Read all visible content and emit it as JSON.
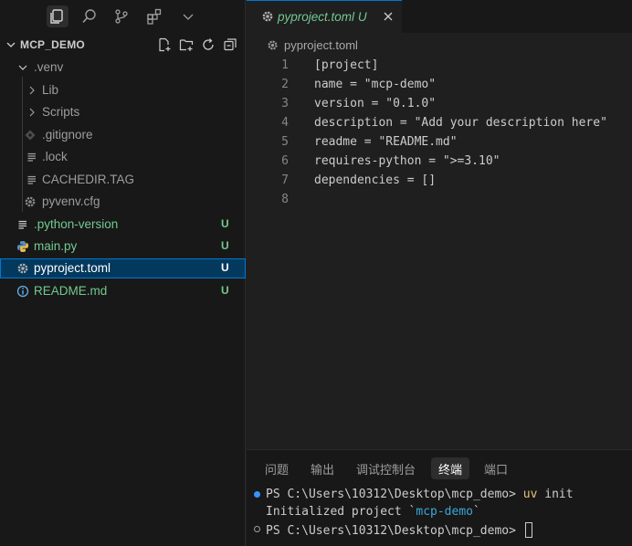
{
  "activity_bar": {
    "icons": [
      "explorer-icon",
      "search-icon",
      "source-control-icon",
      "extensions-icon",
      "more-chevron-icon"
    ]
  },
  "explorer": {
    "title": "MCP_DEMO",
    "actions": [
      "new-file-icon",
      "new-folder-icon",
      "refresh-icon",
      "collapse-all-icon"
    ],
    "items": [
      {
        "label": ".venv",
        "icon": "chevron-down-icon",
        "badge": ""
      },
      {
        "label": "Lib",
        "icon": "chevron-right-icon",
        "badge": ""
      },
      {
        "label": "Scripts",
        "icon": "chevron-right-icon",
        "badge": ""
      },
      {
        "label": ".gitignore",
        "icon": "gitignore-icon",
        "badge": ""
      },
      {
        "label": ".lock",
        "icon": "text-file-icon",
        "badge": ""
      },
      {
        "label": "CACHEDIR.TAG",
        "icon": "text-file-icon",
        "badge": ""
      },
      {
        "label": "pyvenv.cfg",
        "icon": "gear-icon",
        "badge": ""
      },
      {
        "label": ".python-version",
        "icon": "text-file-icon",
        "badge": "U"
      },
      {
        "label": "main.py",
        "icon": "python-icon",
        "badge": "U"
      },
      {
        "label": "pyproject.toml",
        "icon": "gear-icon",
        "badge": "U"
      },
      {
        "label": "README.md",
        "icon": "info-icon",
        "badge": "U"
      }
    ]
  },
  "editor": {
    "tab": {
      "label": "pyproject.toml",
      "status": "U"
    },
    "breadcrumb": "pyproject.toml",
    "lines": [
      {
        "num": "1",
        "text": "[project]"
      },
      {
        "num": "2",
        "text": "name = \"mcp-demo\""
      },
      {
        "num": "3",
        "text": "version = \"0.1.0\""
      },
      {
        "num": "4",
        "text": "description = \"Add your description here\""
      },
      {
        "num": "5",
        "text": "readme = \"README.md\""
      },
      {
        "num": "6",
        "text": "requires-python = \">=3.10\""
      },
      {
        "num": "7",
        "text": "dependencies = []"
      },
      {
        "num": "8",
        "text": ""
      }
    ]
  },
  "panel": {
    "tabs": [
      "问题",
      "输出",
      "调试控制台",
      "终端",
      "端口"
    ],
    "active_tab": "终端",
    "terminal": {
      "line1_prompt": "PS C:\\Users\\10312\\Desktop\\mcp_demo> ",
      "line1_cmd": "uv",
      "line1_args": " init",
      "line2_prefix": "Initialized project `",
      "line2_project": "mcp-demo",
      "line2_suffix": "`",
      "line3_prompt": "PS C:\\Users\\10312\\Desktop\\mcp_demo> "
    }
  },
  "colors": {
    "accent": "#0078d4",
    "untracked": "#73c991",
    "selection": "#04395e"
  }
}
